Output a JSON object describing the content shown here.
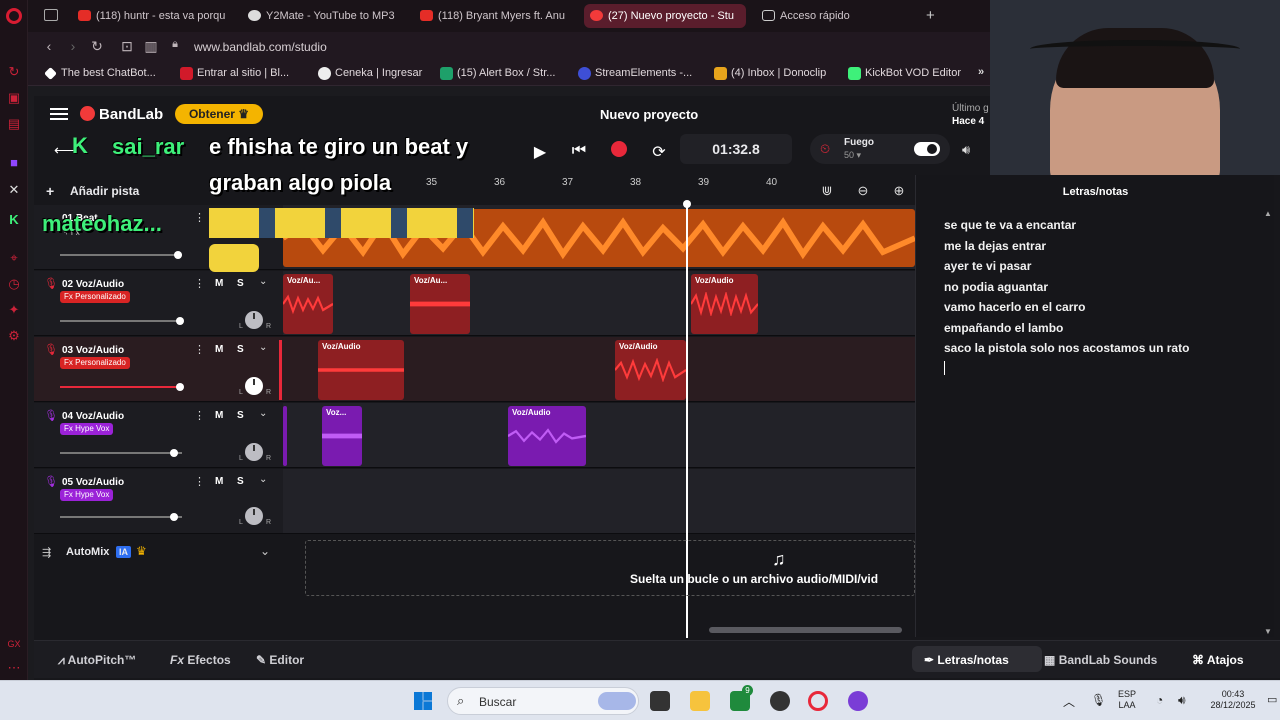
{
  "browser": {
    "tabs": [
      {
        "label": "(118) huntr - esta va porqu",
        "active": false
      },
      {
        "label": "Y2Mate - YouTube to MP3",
        "active": false
      },
      {
        "label": "(118) Bryant Myers ft. Anu",
        "active": false
      },
      {
        "label": "(27) Nuevo proyecto - Stu",
        "active": true
      },
      {
        "label": "Acceso rápido",
        "active": false
      }
    ],
    "url": "www.bandlab.com/studio",
    "bookmarks": [
      "The best ChatBot...",
      "Entrar al sitio | Bl...",
      "Ceneka | Ingresar",
      "(15) Alert Box / Str...",
      "StreamElements -...",
      "(4) Inbox | Donoclip",
      "KickBot VOD Editor"
    ]
  },
  "header": {
    "brand": "BandLab",
    "upgrade_label": "Obtener",
    "project_title": "Nuevo proyecto",
    "save_status_1": "Último g",
    "save_status_2": "Hace 4"
  },
  "transport": {
    "time": "01:32.8",
    "metronome_label": "Fuego",
    "metronome_value": "50"
  },
  "overlay_chat": [
    {
      "user": "sai_rar",
      "message": "e fhisha te giro un beat y",
      "message2": "graban algo piola"
    },
    {
      "user": "mateohaz..."
    }
  ],
  "arrange": {
    "add_track_label": "Añadir pista",
    "ruler": [
      "35",
      "36",
      "37",
      "38",
      "39",
      "40"
    ],
    "tracks": [
      {
        "number": "01",
        "name": "Beat",
        "fx": "+ Fx",
        "fx_color": "",
        "knob": false
      },
      {
        "number": "02",
        "name": "Voz/Audio",
        "fx": "Fx Personalizado",
        "fx_color": "#d82424"
      },
      {
        "number": "03",
        "name": "Voz/Audio",
        "fx": "Fx Personalizado",
        "fx_color": "#d82424"
      },
      {
        "number": "04",
        "name": "Voz/Audio",
        "fx": "Fx Hype Vox",
        "fx_color": "#9b22d8"
      },
      {
        "number": "05",
        "name": "Voz/Audio",
        "fx": "Fx Hype Vox",
        "fx_color": "#9b22d8"
      }
    ],
    "mute_label": "M",
    "solo_label": "S",
    "clip_label": "Voz/Audio",
    "clip_label_short": "Voz/Au...",
    "clip_label_tiny": "Voz...",
    "automix_label": "AutoMix",
    "automix_badge": "IA",
    "drop_text": "Suelta un bucle o un archivo audio/MIDI/vid"
  },
  "lyrics": {
    "title": "Letras/notas",
    "lines": [
      "se que te va a encantar",
      "me la dejas  entrar",
      "ayer te vi pasar",
      "no podia aguantar",
      "vamo hacerlo en el carro",
      "empañando el lambo",
      "saco la pistola solo nos acostamos un rato"
    ]
  },
  "bottom_bar": {
    "autopitch": "AutoPitch™",
    "effects": "Efectos",
    "editor": "Editor",
    "lyrics": "Letras/notas",
    "sounds": "BandLab Sounds",
    "shortcuts": "Atajos"
  },
  "taskbar": {
    "search_placeholder": "Buscar",
    "lang_1": "ESP",
    "lang_2": "LAA",
    "time": "00:43",
    "date": "28/12/2025",
    "store_badge": "9"
  },
  "colors": {
    "accent_red": "#e8283a",
    "beat_orange": "#f5721a",
    "vox_red": "#c0282b",
    "vox_purple": "#8a1fc8",
    "chat_green": "#3ef07a"
  }
}
